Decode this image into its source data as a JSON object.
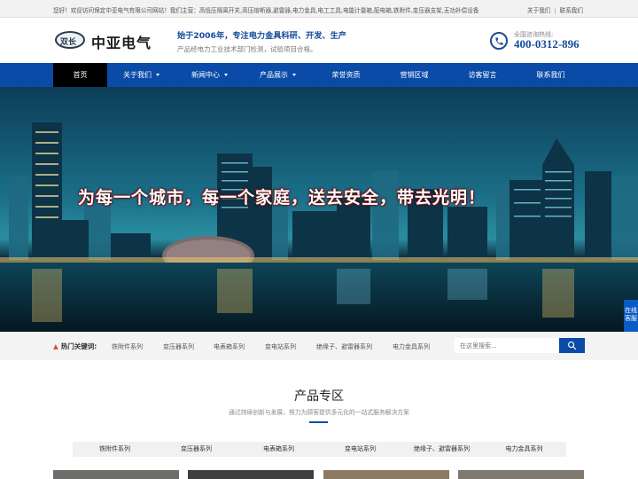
{
  "topbar": {
    "welcome": "您好！欢迎访问保定中亚电气有限公司网站！我们主营：高低压隔离开关,高压熔断器,避雷器,电力金具,电工工具,电能计量箱,配电箱,铁附件,变压器支架,无功补偿设备",
    "about_link": "关于我们",
    "separator": "|",
    "contact_link": "联系我们"
  },
  "header": {
    "logo_mark": "双长",
    "company_name": "中亚电气",
    "slogan_line1": "始于2006年，专注电力金具科研、开发、生产",
    "slogan_line2": "产品经电力工业技术部门检测，试验项目合格。",
    "hotline_label": "全国咨询热线:",
    "hotline_number": "400-0312-896"
  },
  "nav": {
    "items": [
      {
        "label": "首页",
        "active": true,
        "dropdown": false
      },
      {
        "label": "关于我们",
        "active": false,
        "dropdown": true
      },
      {
        "label": "新闻中心",
        "active": false,
        "dropdown": true
      },
      {
        "label": "产品展示",
        "active": false,
        "dropdown": true
      },
      {
        "label": "荣誉资质",
        "active": false,
        "dropdown": false
      },
      {
        "label": "营销区域",
        "active": false,
        "dropdown": false
      },
      {
        "label": "访客留言",
        "active": false,
        "dropdown": false
      },
      {
        "label": "联系我们",
        "active": false,
        "dropdown": false
      }
    ]
  },
  "banner": {
    "slogan": "为每一个城市，每一个家庭，送去安全，带去光明！",
    "side_tab": "在线客服"
  },
  "keywords": {
    "label": "热门关键词:",
    "items": [
      "铁附件系列",
      "变压器系列",
      "电表箱系列",
      "变电站系列",
      "绝缘子、避雷器系列",
      "电力金具系列"
    ],
    "search_placeholder": "在这里搜索..."
  },
  "products": {
    "title": "产品专区",
    "subtitle": "通过持续创新与发展，努力为顾客提供多元化的一站式服务解决方案",
    "categories": [
      "铁附件系列",
      "变压器系列",
      "电表箱系列",
      "变电站系列",
      "绝缘子、避雷器系列",
      "电力金具系列"
    ]
  },
  "colors": {
    "brand_blue": "#0a4ba8",
    "nav_active": "#000000",
    "accent_red": "#c0151b"
  }
}
